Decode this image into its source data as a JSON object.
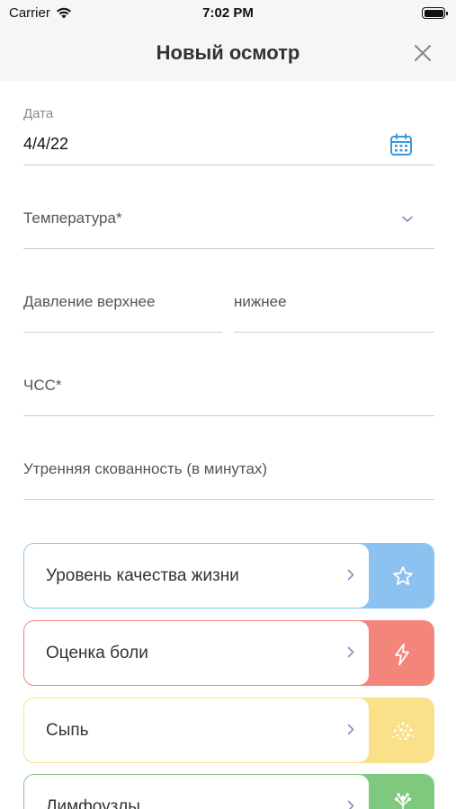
{
  "status_bar": {
    "carrier": "Carrier",
    "time": "7:02 PM",
    "wifi_icon": "wifi-icon",
    "battery_icon": "battery-icon"
  },
  "nav": {
    "title": "Новый осмотр",
    "close_icon": "close-icon"
  },
  "form": {
    "date": {
      "label": "Дата",
      "value": "4/4/22",
      "icon": "calendar-icon"
    },
    "temperature": {
      "placeholder": "Температура*",
      "icon": "chevron-down-icon"
    },
    "pressure_upper": {
      "placeholder": "Давление верхнее"
    },
    "pressure_lower": {
      "placeholder": "нижнее"
    },
    "heart_rate": {
      "placeholder": "ЧСС*"
    },
    "morning_stiffness": {
      "placeholder": "Утренняя скованность (в минутах)"
    }
  },
  "cards": [
    {
      "label": "Уровень качества жизни",
      "icon": "star-icon",
      "color": "#8cc2f0"
    },
    {
      "label": "Оценка боли",
      "icon": "lightning-icon",
      "color": "#f3857b"
    },
    {
      "label": "Сыпь",
      "icon": "rash-icon",
      "color": "#fbe08a"
    },
    {
      "label": "Лимфоузлы",
      "icon": "lymph-node-icon",
      "color": "#7fc97f"
    }
  ],
  "colors": {
    "chevron": "#8a8ac8",
    "calendar": "#3a9ad9"
  }
}
